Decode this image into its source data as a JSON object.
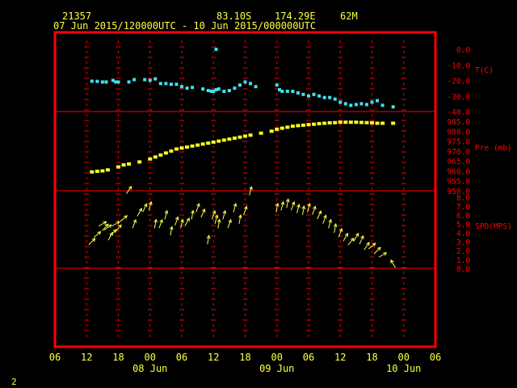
{
  "header": {
    "station": "21357",
    "lat": "83.10S",
    "lon": "174.29E",
    "elev": "62M",
    "range": "07 Jun 2015/120000UTC - 10 Jun 2015/000000UTC"
  },
  "page_number": "2",
  "colors": {
    "frame": "#ff0000",
    "grid": "#ff0000",
    "text_yellow": "#ffff40",
    "temp": "#40e0f0",
    "pressure": "#ffff20",
    "wind": "#ffff40"
  },
  "chart_data": {
    "type": "scatter",
    "x_axis": {
      "unit": "hours since 07 Jun 00UTC",
      "range": [
        6,
        78
      ],
      "tick_labels": [
        "06",
        "12",
        "18",
        "00",
        "06",
        "12",
        "18",
        "00",
        "06",
        "12",
        "18",
        "00",
        "06"
      ],
      "tick_values": [
        6,
        12,
        18,
        24,
        30,
        36,
        42,
        48,
        54,
        60,
        66,
        72,
        78
      ],
      "day_labels": [
        "08 Jun",
        "09 Jun",
        "10 Jun"
      ]
    },
    "panels": [
      {
        "name": "T(C)",
        "y_range": [
          -40,
          0
        ],
        "tick_labels": [
          "0.0",
          "-10.0",
          "-20.0",
          "-30.0",
          "-40.0"
        ],
        "tick_values": [
          0,
          -10,
          -20,
          -30,
          -40
        ],
        "series": {
          "x": [
            13,
            14,
            15,
            15.7,
            17,
            17.5,
            18,
            20,
            21,
            23,
            24,
            25,
            26,
            27,
            28,
            29,
            30,
            31,
            32,
            34,
            35,
            35.6,
            36,
            36.5,
            37,
            38,
            39,
            40,
            41,
            42,
            43,
            44,
            48,
            48.5,
            49,
            50,
            51,
            52,
            53,
            54,
            55,
            56,
            57,
            58,
            59,
            60,
            61,
            62,
            63,
            64,
            65,
            66,
            67,
            68,
            70
          ],
          "y": [
            -20.5,
            -20.6,
            -21,
            -21,
            -20,
            -21,
            -21,
            -21,
            -19.5,
            -19.5,
            -20,
            -19,
            -22,
            -22,
            -22.5,
            -22.5,
            -24,
            -25,
            -24.5,
            -25.5,
            -26.5,
            -27,
            -27,
            -26,
            -25.5,
            -27,
            -26.5,
            -25,
            -23,
            -21,
            -22,
            -24,
            -23,
            -26,
            -27,
            -27,
            -27,
            -28,
            -29,
            -30,
            -29,
            -30,
            -31,
            -31,
            -32,
            -34,
            -35,
            -36,
            -35.5,
            -35,
            -35.5,
            -34,
            -33,
            -36,
            -37
          ]
        },
        "outliers": [
          {
            "x": 36.5,
            "y": 0
          }
        ]
      },
      {
        "name": "Pre (mb)",
        "y_range": [
          950,
          985
        ],
        "tick_labels": [
          "985.0",
          "980.0",
          "975.0",
          "970.0",
          "965.0",
          "960.0",
          "955.0",
          "950.0"
        ],
        "tick_values": [
          985,
          980,
          975,
          970,
          965,
          960,
          955,
          950
        ],
        "series": {
          "x": [
            13,
            14,
            15,
            16,
            18,
            19,
            20,
            22,
            24,
            25,
            26,
            27,
            28,
            29,
            30,
            31,
            32,
            33,
            34,
            35,
            36,
            37,
            38,
            39,
            40,
            41,
            42,
            43,
            45,
            47,
            48,
            49,
            50,
            51,
            52,
            53,
            54,
            55,
            56,
            57,
            58,
            59,
            60,
            61,
            62,
            63,
            64,
            65,
            66,
            67,
            68,
            70
          ],
          "y": [
            959.5,
            959.8,
            960.0,
            960.5,
            962,
            963,
            963.5,
            964.5,
            966,
            967,
            968,
            969,
            970,
            971,
            971.5,
            972,
            972.5,
            973,
            973.5,
            974,
            974.5,
            975,
            975.5,
            976,
            976.5,
            977,
            977.5,
            978,
            979,
            980,
            981,
            981.5,
            982,
            982.5,
            982.8,
            983,
            983.3,
            983.5,
            983.8,
            984,
            984.2,
            984.3,
            984.5,
            984.5,
            984.5,
            984.5,
            984.4,
            984.3,
            984.2,
            984.0,
            984.0,
            984.0
          ]
        }
      },
      {
        "name": "SPD(MPS)",
        "y_range": [
          0,
          8
        ],
        "tick_labels": [
          "8.0",
          "7.0",
          "6.0",
          "5.0",
          "4.0",
          "3.0",
          "2.0",
          "1.0",
          "0.0"
        ],
        "tick_values": [
          8,
          7,
          6,
          5,
          4,
          3,
          2,
          1,
          0
        ],
        "series": {
          "x": [
            13,
            14,
            15,
            15.5,
            16,
            16.5,
            17,
            17.5,
            18,
            19,
            20,
            21,
            22,
            23,
            24,
            25,
            26,
            27,
            28,
            29,
            30,
            31,
            32,
            33,
            34,
            35,
            36,
            36.5,
            37,
            38,
            39,
            40,
            41,
            42,
            43,
            48,
            49,
            50,
            51,
            52,
            53,
            54,
            55,
            56,
            57,
            58,
            59,
            60,
            61,
            62,
            63,
            64,
            65,
            66,
            67,
            68,
            70
          ],
          "y": [
            3.0,
            3.8,
            5.0,
            4.6,
            4.6,
            3.6,
            4.0,
            5.0,
            4.5,
            5.6,
            8.8,
            5.0,
            6.3,
            6.8,
            7.0,
            5.0,
            5.0,
            6.0,
            4.2,
            5.3,
            5.0,
            5.2,
            6.0,
            6.8,
            6.2,
            3.2,
            6.0,
            5.5,
            5.0,
            6.0,
            5.0,
            6.8,
            5.5,
            6.5,
            8.7,
            6.8,
            7.0,
            7.3,
            7.0,
            6.7,
            6.5,
            6.8,
            6.5,
            6.0,
            5.5,
            5.0,
            4.5,
            4.0,
            3.5,
            3.0,
            3.5,
            3.2,
            2.5,
            2.5,
            2.0,
            1.5,
            0.5
          ],
          "dir_deg": [
            45,
            50,
            60,
            40,
            55,
            30,
            45,
            60,
            40,
            50,
            35,
            20,
            30,
            25,
            15,
            10,
            20,
            15,
            10,
            20,
            15,
            30,
            10,
            20,
            25,
            10,
            20,
            15,
            10,
            15,
            20,
            15,
            10,
            20,
            15,
            10,
            15,
            10,
            20,
            15,
            10,
            15,
            20,
            25,
            20,
            15,
            10,
            20,
            30,
            40,
            30,
            25,
            35,
            50,
            45,
            60,
            -30
          ]
        }
      }
    ]
  }
}
